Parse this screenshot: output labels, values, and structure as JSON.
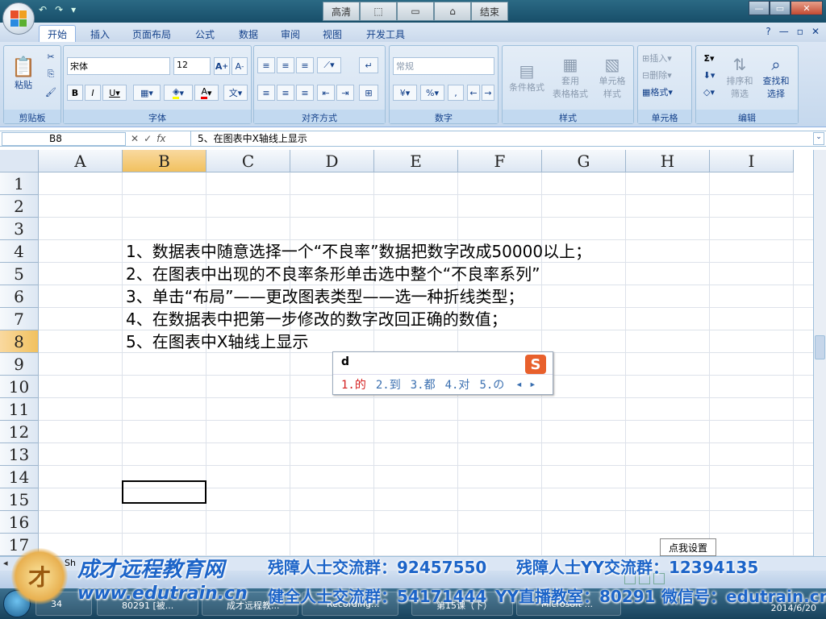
{
  "window": {
    "qat_icons": [
      "undo-icon",
      "redo-icon",
      "save-icon"
    ],
    "mid_buttons": [
      "高清",
      "",
      "",
      "",
      "结束"
    ],
    "controls": [
      "—",
      "▭",
      "✕"
    ]
  },
  "tabs": [
    "开始",
    "插入",
    "页面布局",
    "公式",
    "数据",
    "审阅",
    "视图",
    "开发工具"
  ],
  "ribbon": {
    "clipboard": {
      "label": "剪贴板",
      "paste": "粘贴"
    },
    "font": {
      "label": "字体",
      "name": "宋体",
      "size": "12"
    },
    "alignment": {
      "label": "对齐方式"
    },
    "number": {
      "label": "数字",
      "format": "常规"
    },
    "styles": {
      "label": "样式",
      "cond": "条件格式",
      "table1": "套用",
      "table2": "表格格式",
      "cell1": "单元格",
      "cell2": "样式"
    },
    "cells": {
      "label": "单元格",
      "insert": "插入",
      "delete": "删除",
      "format": "格式"
    },
    "editing": {
      "label": "编辑",
      "sort1": "排序和",
      "sort2": "筛选",
      "find1": "查找和",
      "find2": "选择"
    }
  },
  "formula_bar": {
    "name_box": "B8",
    "fx": "fx",
    "content": "5、在图表中X轴线上显示"
  },
  "columns": [
    "A",
    "B",
    "C",
    "D",
    "E",
    "F",
    "G",
    "H",
    "I"
  ],
  "rows": [
    "1",
    "2",
    "3",
    "4",
    "5",
    "6",
    "7",
    "8",
    "9",
    "10",
    "11",
    "12",
    "13",
    "14",
    "15",
    "16",
    "17"
  ],
  "cells": [
    {
      "row": "4",
      "text": "1、数据表中随意选择一个“不良率”数据把数字改成50000以上；"
    },
    {
      "row": "5",
      "text": "2、在图表中出现的不良率条形单击选中整个“不良率系列”"
    },
    {
      "row": "6",
      "text": "3、单击“布局”——更改图表类型——选一种折线类型；"
    },
    {
      "row": "7",
      "text": "4、在数据表中把第一步修改的数字改回正确的数值；"
    },
    {
      "row": "8",
      "text": "5、在图表中X轴线上显示"
    }
  ],
  "ime": {
    "input": "d",
    "candidates": [
      "1.的",
      "2.到",
      "3.都",
      "4.对",
      "5.の"
    ]
  },
  "tooltip": "点我设置",
  "sheet_tab": "Sh",
  "watermark": {
    "site_cn": "成才远程教育网",
    "site_url": "www.edutrain.cn",
    "line1a": "残障人士交流群：92457550",
    "line1b": "残障人士YY交流群：12394135",
    "line2a": "健全人士交流群：54171444",
    "line2b": "YY直播教室：80291",
    "line2c": "微信号：edutrain.cn"
  },
  "taskbar": {
    "items": [
      "80291 [被...",
      "成才远程教...",
      "Recording...",
      "第15课（下）",
      "Microsoft ..."
    ],
    "clock_date": "2014/6/20",
    "start_num": "34"
  }
}
